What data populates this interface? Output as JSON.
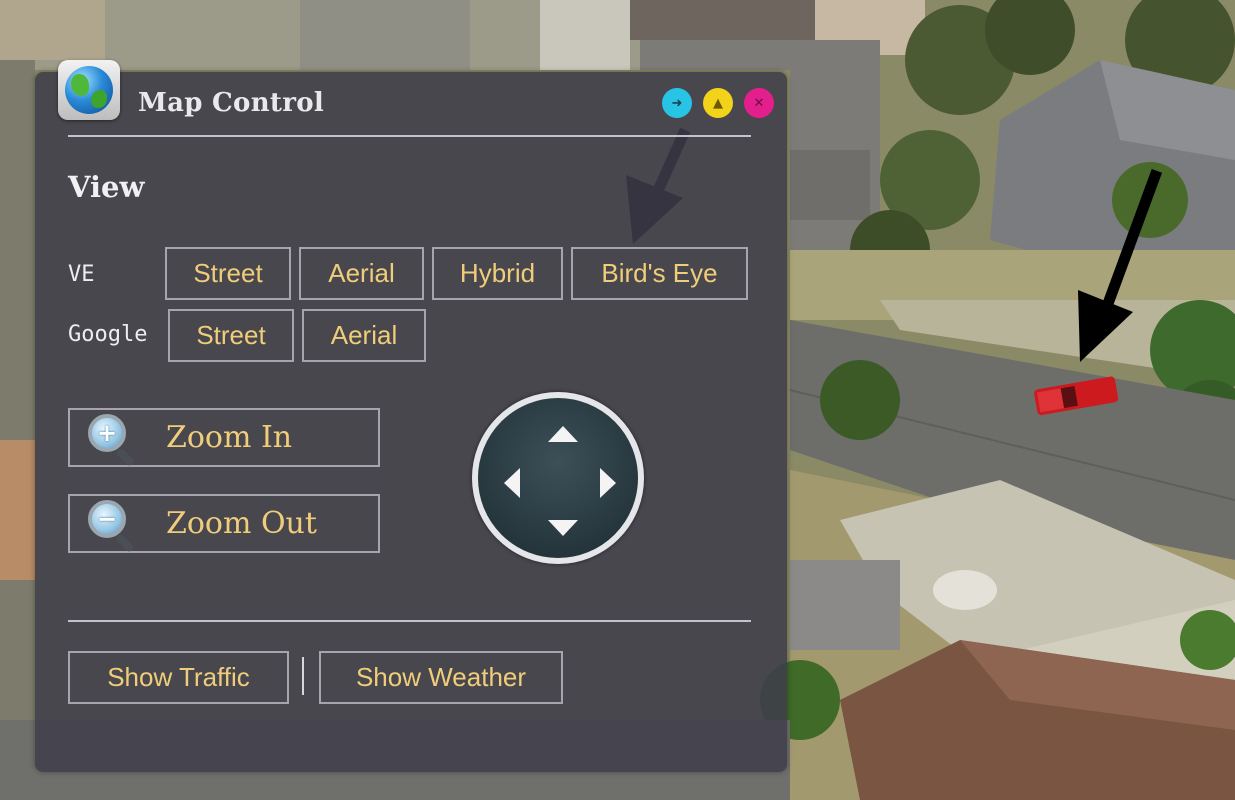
{
  "panel": {
    "title": "Map Control",
    "app_icon": "globe-icon",
    "window_buttons": {
      "dock": "arrow-right-icon",
      "minimize": "chevron-up-icon",
      "close": "close-icon"
    }
  },
  "view": {
    "heading": "View",
    "ve": {
      "label": "VE",
      "buttons": [
        "Street",
        "Aerial",
        "Hybrid",
        "Bird's Eye"
      ]
    },
    "google": {
      "label": "Google",
      "buttons": [
        "Street",
        "Aerial"
      ]
    }
  },
  "zoom": {
    "zoom_in": "Zoom In",
    "zoom_out": "Zoom Out"
  },
  "pan": {
    "icons": [
      "pan-up-icon",
      "pan-down-icon",
      "pan-left-icon",
      "pan-right-icon"
    ]
  },
  "footer": {
    "traffic": "Show Traffic",
    "weather": "Show Weather"
  },
  "colors": {
    "panel_bg": "#3e3c4a",
    "button_text": "#f0cd7a",
    "accent_cyan": "#27c4e6",
    "accent_yellow": "#f3d31a",
    "accent_magenta": "#e21f8c"
  }
}
